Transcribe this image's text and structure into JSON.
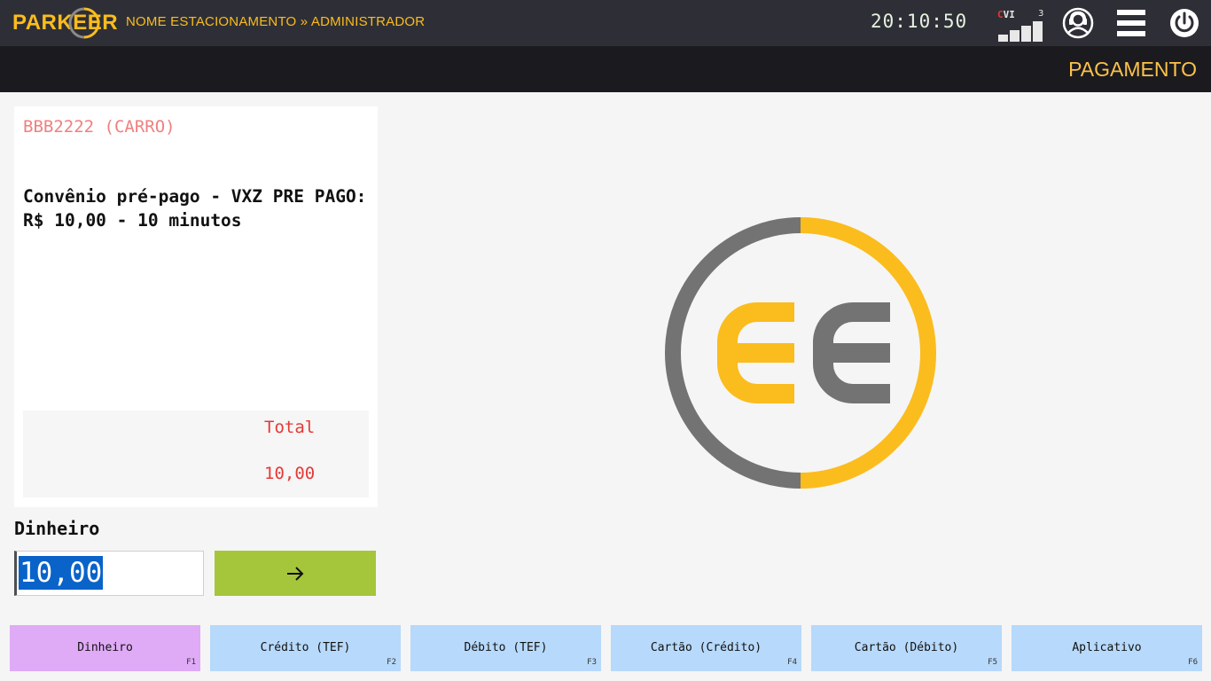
{
  "header": {
    "logo_text": "PARKEER",
    "breadcrumb": "NOME ESTACIONAMENTO » ADMINISTRADOR",
    "clock": "20:10:50",
    "signal": {
      "label_red": "C",
      "label_rest": "VI",
      "level": "3"
    },
    "icons": [
      "user-support-icon",
      "menu-icon",
      "power-icon"
    ]
  },
  "page": {
    "title": "PAGAMENTO"
  },
  "ticket": {
    "plate": "BBB2222 (CARRO)",
    "description": "Convênio pré-pago - VXZ PRE PAGO: R$ 10,00 - 10 minutos",
    "total_label": "Total",
    "total_value": "10,00"
  },
  "payment": {
    "method_label": "Dinheiro",
    "amount_value": "10,00",
    "submit_icon": "arrow-right-icon"
  },
  "methods": [
    {
      "label": "Dinheiro",
      "key": "F1",
      "active": true
    },
    {
      "label": "Crédito (TEF)",
      "key": "F2",
      "active": false
    },
    {
      "label": "Débito (TEF)",
      "key": "F3",
      "active": false
    },
    {
      "label": "Cartão (Crédito)",
      "key": "F4",
      "active": false
    },
    {
      "label": "Cartão (Débito)",
      "key": "F5",
      "active": false
    },
    {
      "label": "Aplicativo",
      "key": "F6",
      "active": false
    }
  ],
  "colors": {
    "brand_yellow": "#fbbc1d",
    "brand_gray": "#737373",
    "topbar": "#2e2f36",
    "titlebar": "#1b1b1f",
    "accent_red": "#e53935",
    "confirm_green": "#a5c63a",
    "method_active": "#dfaaf6",
    "method_default": "#b7d9fb"
  }
}
